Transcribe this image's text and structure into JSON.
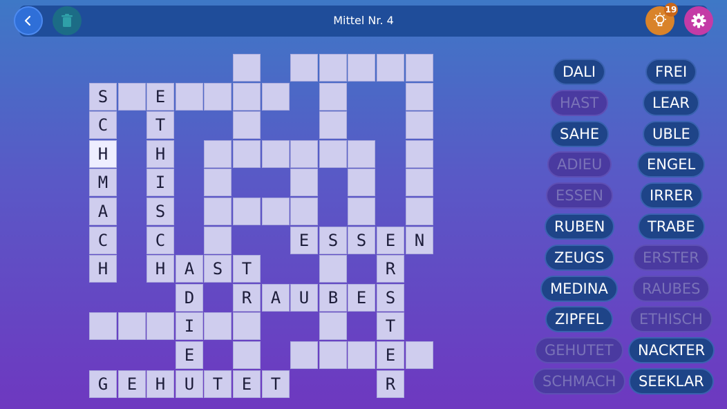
{
  "header": {
    "title": "Mittel Nr. 4",
    "hint_count": "19",
    "back_icon": "chevron-left-icon",
    "trash_icon": "trash-icon",
    "hint_icon": "lightbulb-icon",
    "settings_icon": "gear-icon"
  },
  "colors": {
    "cell": "#cfcdee",
    "cell_highlight": "#eeeeff",
    "word_active": "#1e4488",
    "word_done": "#4a3aa0"
  },
  "grid": {
    "rows": 12,
    "cols": 12,
    "cells": [
      {
        "r": 0,
        "c": 5,
        "t": ""
      },
      {
        "r": 0,
        "c": 7,
        "t": ""
      },
      {
        "r": 0,
        "c": 8,
        "t": ""
      },
      {
        "r": 0,
        "c": 9,
        "t": ""
      },
      {
        "r": 0,
        "c": 10,
        "t": ""
      },
      {
        "r": 0,
        "c": 11,
        "t": ""
      },
      {
        "r": 1,
        "c": 0,
        "t": "S"
      },
      {
        "r": 1,
        "c": 1,
        "t": ""
      },
      {
        "r": 1,
        "c": 2,
        "t": "E"
      },
      {
        "r": 1,
        "c": 3,
        "t": ""
      },
      {
        "r": 1,
        "c": 4,
        "t": ""
      },
      {
        "r": 1,
        "c": 5,
        "t": ""
      },
      {
        "r": 1,
        "c": 6,
        "t": ""
      },
      {
        "r": 1,
        "c": 8,
        "t": ""
      },
      {
        "r": 1,
        "c": 11,
        "t": ""
      },
      {
        "r": 2,
        "c": 0,
        "t": "C"
      },
      {
        "r": 2,
        "c": 2,
        "t": "T"
      },
      {
        "r": 2,
        "c": 5,
        "t": ""
      },
      {
        "r": 2,
        "c": 8,
        "t": ""
      },
      {
        "r": 2,
        "c": 11,
        "t": ""
      },
      {
        "r": 3,
        "c": 0,
        "t": "H",
        "hl": true
      },
      {
        "r": 3,
        "c": 2,
        "t": "H"
      },
      {
        "r": 3,
        "c": 4,
        "t": ""
      },
      {
        "r": 3,
        "c": 5,
        "t": ""
      },
      {
        "r": 3,
        "c": 6,
        "t": ""
      },
      {
        "r": 3,
        "c": 7,
        "t": ""
      },
      {
        "r": 3,
        "c": 8,
        "t": ""
      },
      {
        "r": 3,
        "c": 9,
        "t": ""
      },
      {
        "r": 3,
        "c": 11,
        "t": ""
      },
      {
        "r": 4,
        "c": 0,
        "t": "M"
      },
      {
        "r": 4,
        "c": 2,
        "t": "I"
      },
      {
        "r": 4,
        "c": 4,
        "t": ""
      },
      {
        "r": 4,
        "c": 7,
        "t": ""
      },
      {
        "r": 4,
        "c": 9,
        "t": ""
      },
      {
        "r": 4,
        "c": 11,
        "t": ""
      },
      {
        "r": 5,
        "c": 0,
        "t": "A"
      },
      {
        "r": 5,
        "c": 2,
        "t": "S"
      },
      {
        "r": 5,
        "c": 4,
        "t": ""
      },
      {
        "r": 5,
        "c": 5,
        "t": ""
      },
      {
        "r": 5,
        "c": 6,
        "t": ""
      },
      {
        "r": 5,
        "c": 7,
        "t": ""
      },
      {
        "r": 5,
        "c": 9,
        "t": ""
      },
      {
        "r": 5,
        "c": 11,
        "t": ""
      },
      {
        "r": 6,
        "c": 0,
        "t": "C"
      },
      {
        "r": 6,
        "c": 2,
        "t": "C"
      },
      {
        "r": 6,
        "c": 4,
        "t": ""
      },
      {
        "r": 6,
        "c": 7,
        "t": "E"
      },
      {
        "r": 6,
        "c": 8,
        "t": "S"
      },
      {
        "r": 6,
        "c": 9,
        "t": "S"
      },
      {
        "r": 6,
        "c": 10,
        "t": "E"
      },
      {
        "r": 6,
        "c": 11,
        "t": "N"
      },
      {
        "r": 7,
        "c": 0,
        "t": "H"
      },
      {
        "r": 7,
        "c": 2,
        "t": "H"
      },
      {
        "r": 7,
        "c": 3,
        "t": "A"
      },
      {
        "r": 7,
        "c": 4,
        "t": "S"
      },
      {
        "r": 7,
        "c": 5,
        "t": "T"
      },
      {
        "r": 7,
        "c": 8,
        "t": ""
      },
      {
        "r": 7,
        "c": 10,
        "t": "R"
      },
      {
        "r": 8,
        "c": 3,
        "t": "D"
      },
      {
        "r": 8,
        "c": 5,
        "t": "R"
      },
      {
        "r": 8,
        "c": 6,
        "t": "A"
      },
      {
        "r": 8,
        "c": 7,
        "t": "U"
      },
      {
        "r": 8,
        "c": 8,
        "t": "B"
      },
      {
        "r": 8,
        "c": 9,
        "t": "E"
      },
      {
        "r": 8,
        "c": 10,
        "t": "S"
      },
      {
        "r": 9,
        "c": 0,
        "t": ""
      },
      {
        "r": 9,
        "c": 1,
        "t": ""
      },
      {
        "r": 9,
        "c": 2,
        "t": ""
      },
      {
        "r": 9,
        "c": 3,
        "t": "I"
      },
      {
        "r": 9,
        "c": 4,
        "t": ""
      },
      {
        "r": 9,
        "c": 5,
        "t": ""
      },
      {
        "r": 9,
        "c": 8,
        "t": ""
      },
      {
        "r": 9,
        "c": 10,
        "t": "T"
      },
      {
        "r": 10,
        "c": 3,
        "t": "E"
      },
      {
        "r": 10,
        "c": 5,
        "t": ""
      },
      {
        "r": 10,
        "c": 7,
        "t": ""
      },
      {
        "r": 10,
        "c": 8,
        "t": ""
      },
      {
        "r": 10,
        "c": 9,
        "t": ""
      },
      {
        "r": 10,
        "c": 10,
        "t": "E"
      },
      {
        "r": 10,
        "c": 11,
        "t": ""
      },
      {
        "r": 11,
        "c": 0,
        "t": "G"
      },
      {
        "r": 11,
        "c": 1,
        "t": "E"
      },
      {
        "r": 11,
        "c": 2,
        "t": "H"
      },
      {
        "r": 11,
        "c": 3,
        "t": "U"
      },
      {
        "r": 11,
        "c": 4,
        "t": "T"
      },
      {
        "r": 11,
        "c": 5,
        "t": "E"
      },
      {
        "r": 11,
        "c": 6,
        "t": "T"
      },
      {
        "r": 11,
        "c": 10,
        "t": "R"
      }
    ]
  },
  "word_list": {
    "left": [
      {
        "label": "DALI",
        "done": false
      },
      {
        "label": "HAST",
        "done": true
      },
      {
        "label": "SAHE",
        "done": false
      },
      {
        "label": "ADIEU",
        "done": true
      },
      {
        "label": "ESSEN",
        "done": true
      },
      {
        "label": "RUBEN",
        "done": false
      },
      {
        "label": "ZEUGS",
        "done": false
      },
      {
        "label": "MEDINA",
        "done": false
      },
      {
        "label": "ZIPFEL",
        "done": false
      },
      {
        "label": "GEHUTET",
        "done": true
      },
      {
        "label": "SCHMACH",
        "done": true
      }
    ],
    "right": [
      {
        "label": "FREI",
        "done": false
      },
      {
        "label": "LEAR",
        "done": false
      },
      {
        "label": "UBLE",
        "done": false
      },
      {
        "label": "ENGEL",
        "done": false
      },
      {
        "label": "IRRER",
        "done": false
      },
      {
        "label": "TRABE",
        "done": false
      },
      {
        "label": "ERSTER",
        "done": true
      },
      {
        "label": "RAUBES",
        "done": true
      },
      {
        "label": "ETHISCH",
        "done": true
      },
      {
        "label": "NACKTER",
        "done": false
      },
      {
        "label": "SEEKLAR",
        "done": false
      }
    ]
  }
}
